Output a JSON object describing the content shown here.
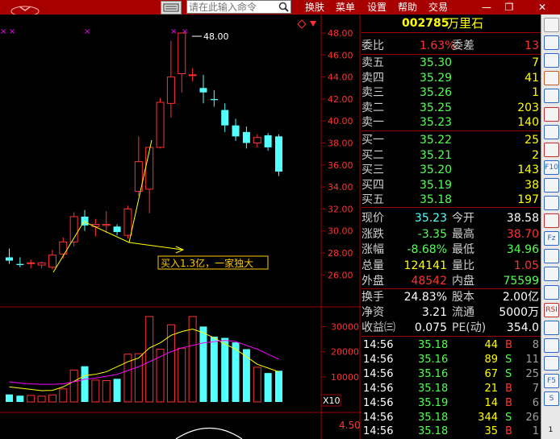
{
  "search": {
    "placeholder": "请在此输入命令"
  },
  "menu": [
    "换肤",
    "菜单",
    "设置",
    "帮助",
    "交易"
  ],
  "window": {
    "min": "—",
    "max": "❐",
    "close": "✕"
  },
  "colors": {
    "up": "#ff3232",
    "down": "#54ffff",
    "flat": "#ffffff",
    "yellow": "#ffff00",
    "gold": "#ffc800",
    "magenta": "#ff00ff"
  },
  "annotation": {
    "peak": "48.00",
    "text": "买入1.3亿，一家独大"
  },
  "chart_data": {
    "type": "candlestick",
    "price_axis": [
      "48.00",
      "46.00",
      "44.00",
      "42.00",
      "40.00",
      "38.00",
      "36.00",
      "34.00",
      "32.00",
      "30.00",
      "28.00",
      "26.00"
    ],
    "volume_axis": [
      "30000",
      "20000",
      "10000"
    ],
    "volume_unit": "X10",
    "indicator_value": "4.50",
    "candles": [
      {
        "o": 27.6,
        "h": 28.4,
        "l": 27.0,
        "c": 27.3
      },
      {
        "o": 27.0,
        "h": 27.6,
        "l": 26.7,
        "c": 26.9
      },
      {
        "o": 27.1,
        "h": 27.4,
        "l": 26.6,
        "c": 27.1
      },
      {
        "o": 26.9,
        "h": 27.2,
        "l": 26.6,
        "c": 27.1
      },
      {
        "o": 26.7,
        "h": 28.3,
        "l": 26.5,
        "c": 27.8
      },
      {
        "o": 27.9,
        "h": 29.4,
        "l": 27.5,
        "c": 29.0
      },
      {
        "o": 29.0,
        "h": 31.7,
        "l": 28.6,
        "c": 31.3
      },
      {
        "o": 31.3,
        "h": 31.9,
        "l": 30.0,
        "c": 30.5
      },
      {
        "o": 30.4,
        "h": 31.1,
        "l": 29.5,
        "c": 30.6
      },
      {
        "o": 30.5,
        "h": 31.8,
        "l": 29.8,
        "c": 30.6
      },
      {
        "o": 30.4,
        "h": 30.6,
        "l": 29.6,
        "c": 29.9
      },
      {
        "o": 29.6,
        "h": 32.3,
        "l": 29.3,
        "c": 32.0
      },
      {
        "o": 33.6,
        "h": 38.6,
        "l": 33.2,
        "c": 36.3
      },
      {
        "o": 33.8,
        "h": 37.4,
        "l": 31.6,
        "c": 37.6
      },
      {
        "o": 37.6,
        "h": 42.1,
        "l": 37.5,
        "c": 41.7
      },
      {
        "o": 41.6,
        "h": 47.3,
        "l": 40.3,
        "c": 44.0
      },
      {
        "o": 44.3,
        "h": 48.0,
        "l": 42.6,
        "c": 48.0
      },
      {
        "o": 44.2,
        "h": 44.8,
        "l": 43.6,
        "c": 44.2
      },
      {
        "o": 43.0,
        "h": 44.2,
        "l": 41.6,
        "c": 42.6
      },
      {
        "o": 42.0,
        "h": 42.8,
        "l": 41.3,
        "c": 41.9
      },
      {
        "o": 41.0,
        "h": 41.6,
        "l": 39.0,
        "c": 39.6
      },
      {
        "o": 39.6,
        "h": 40.2,
        "l": 38.2,
        "c": 38.6
      },
      {
        "o": 39.0,
        "h": 39.5,
        "l": 37.5,
        "c": 38.0
      },
      {
        "o": 38.0,
        "h": 38.8,
        "l": 37.6,
        "c": 38.5
      },
      {
        "o": 38.7,
        "h": 38.9,
        "l": 37.3,
        "c": 37.6
      },
      {
        "o": 38.6,
        "h": 38.8,
        "l": 35.0,
        "c": 35.4
      }
    ],
    "volumes": [
      3000,
      2500,
      2600,
      2300,
      2800,
      5200,
      12700,
      14200,
      8700,
      8500,
      9200,
      19000,
      19200,
      34000,
      21000,
      30700,
      21400,
      34000,
      30000,
      26000,
      25500,
      23700,
      21000,
      13800,
      11500,
      12400
    ],
    "ma_short": [
      6000,
      5500,
      5000,
      4500,
      4600,
      6000,
      8200,
      10500,
      11000,
      12000,
      14000,
      16000,
      17500,
      21500,
      23500,
      26500,
      28000,
      29000,
      27500,
      25500,
      23000,
      21000,
      18000,
      15000,
      13500,
      12000
    ],
    "ma_long": [
      8000,
      7500,
      7200,
      7000,
      7000,
      7200,
      8000,
      9000,
      9500,
      10200,
      11000,
      12500,
      14000,
      16000,
      18000,
      20000,
      21500,
      22500,
      23500,
      24000,
      24500,
      24000,
      22500,
      21000,
      19000,
      17000
    ]
  },
  "quote": {
    "code": "002785",
    "name": "万里石",
    "weibi": {
      "label": "委比",
      "value": "1.63%",
      "label2": "委差",
      "value2": "13"
    },
    "asks": [
      {
        "label": "卖五",
        "price": "35.30",
        "vol": "7"
      },
      {
        "label": "卖四",
        "price": "35.29",
        "vol": "41"
      },
      {
        "label": "卖三",
        "price": "35.26",
        "vol": "1"
      },
      {
        "label": "卖二",
        "price": "35.25",
        "vol": "203"
      },
      {
        "label": "卖一",
        "price": "35.23",
        "vol": "140"
      }
    ],
    "bids": [
      {
        "label": "买一",
        "price": "35.22",
        "vol": "25"
      },
      {
        "label": "买二",
        "price": "35.21",
        "vol": "2"
      },
      {
        "label": "买三",
        "price": "35.20",
        "vol": "143"
      },
      {
        "label": "买四",
        "price": "35.19",
        "vol": "38"
      },
      {
        "label": "买五",
        "price": "35.18",
        "vol": "197"
      }
    ],
    "stats": [
      {
        "l1": "现价",
        "v1": "35.23",
        "c1": "#54ffff",
        "l2": "今开",
        "v2": "38.58",
        "c2": "#ffffff"
      },
      {
        "l1": "涨跌",
        "v1": "-3.35",
        "c1": "#54ff54",
        "l2": "最高",
        "v2": "38.70",
        "c2": "#ff3232"
      },
      {
        "l1": "涨幅",
        "v1": "-8.68%",
        "c1": "#54ff54",
        "l2": "最低",
        "v2": "34.96",
        "c2": "#54ff54"
      },
      {
        "l1": "总量",
        "v1": "124141",
        "c1": "#ffff00",
        "l2": "量比",
        "v2": "1.05",
        "c2": "#ff3232"
      },
      {
        "l1": "外盘",
        "v1": "48542",
        "c1": "#ff3232",
        "l2": "内盘",
        "v2": "75599",
        "c2": "#54ff54"
      }
    ],
    "info": [
      {
        "l1": "换手",
        "v1": "24.83%",
        "l2": "股本",
        "v2": "2.00亿"
      },
      {
        "l1": "净资",
        "v1": "3.21",
        "l2": "流通",
        "v2": "5000万"
      },
      {
        "l1": "收益㈢",
        "v1": "0.075",
        "l2": "PE(动)",
        "v2": "354.0"
      }
    ],
    "trades": [
      {
        "time": "14:56",
        "price": "35.18",
        "vol": "44",
        "side": "B",
        "cnt": "8"
      },
      {
        "time": "14:56",
        "price": "35.16",
        "vol": "89",
        "side": "S",
        "cnt": "11"
      },
      {
        "time": "14:56",
        "price": "35.16",
        "vol": "67",
        "side": "S",
        "cnt": "25"
      },
      {
        "time": "14:56",
        "price": "35.18",
        "vol": "21",
        "side": "B",
        "cnt": "7"
      },
      {
        "time": "14:56",
        "price": "35.19",
        "vol": "14",
        "side": "B",
        "cnt": "6"
      },
      {
        "time": "14:56",
        "price": "35.18",
        "vol": "344",
        "side": "S",
        "cnt": "26"
      },
      {
        "time": "14:56",
        "price": "35.18",
        "vol": "35",
        "side": "B",
        "cnt": "1"
      }
    ]
  },
  "toolbar": {
    "icons": [
      "up-arrow-icon",
      "grid-icon",
      "k-line-icon",
      "table-icon",
      "bar-chart-icon",
      "line-chart-icon",
      "candle-icon",
      "bars-icon",
      "f10-icon",
      "list-icon",
      "doc-icon",
      "chart-icon",
      "f2-icon",
      "box-icon",
      "ring-icon",
      "mail-icon",
      "rsi-icon",
      "card-icon",
      "move-icon",
      "text-icon",
      "f5-icon",
      "s-icon"
    ],
    "labels": [
      "",
      "",
      "",
      "",
      "",
      "",
      "",
      "",
      "F10",
      "",
      "",
      "",
      "Fz",
      "",
      "",
      "",
      "RSI",
      "",
      "",
      "",
      "F5",
      "S"
    ],
    "page": "1"
  }
}
